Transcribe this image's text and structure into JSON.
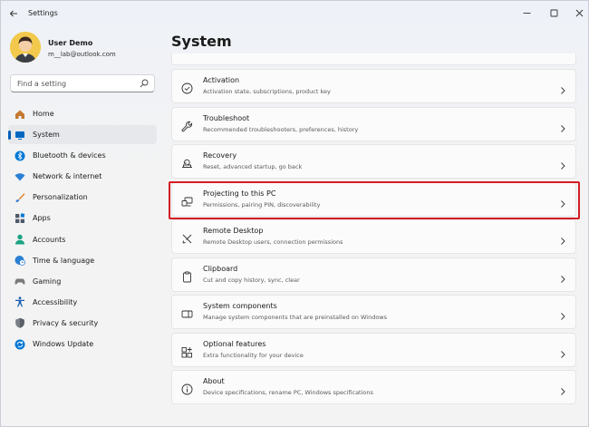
{
  "window": {
    "title": "Settings",
    "back_icon": "arrow-left-icon",
    "controls": [
      "minimize-icon",
      "maximize-icon",
      "close-icon"
    ]
  },
  "profile": {
    "name": "User Demo",
    "email": "m__lab@outlook.com"
  },
  "search": {
    "placeholder": "Find a setting",
    "icon": "search-icon"
  },
  "sidebar": {
    "selected": "System",
    "items": [
      {
        "label": "Home",
        "icon": "home-icon",
        "color": "#c47a30"
      },
      {
        "label": "System",
        "icon": "monitor-icon",
        "color": "#0067c0"
      },
      {
        "label": "Bluetooth & devices",
        "icon": "bluetooth-icon",
        "color": "#0078d4"
      },
      {
        "label": "Network & internet",
        "icon": "wifi-icon",
        "color": "#2a7fd4"
      },
      {
        "label": "Personalization",
        "icon": "brush-icon",
        "color": "#e0802c"
      },
      {
        "label": "Apps",
        "icon": "apps-icon",
        "color": "#505a6a"
      },
      {
        "label": "Accounts",
        "icon": "person-icon",
        "color": "#1aa383"
      },
      {
        "label": "Time & language",
        "icon": "globe-clock-icon",
        "color": "#2a7fd4"
      },
      {
        "label": "Gaming",
        "icon": "gamepad-icon",
        "color": "#7a7a7a"
      },
      {
        "label": "Accessibility",
        "icon": "accessibility-icon",
        "color": "#1a5fb4"
      },
      {
        "label": "Privacy & security",
        "icon": "shield-icon",
        "color": "#7a7f87"
      },
      {
        "label": "Windows Update",
        "icon": "update-icon",
        "color": "#0078d4"
      }
    ]
  },
  "main": {
    "title": "System",
    "highlight_color": "#d41c24",
    "cards": [
      {
        "title": "Activation",
        "desc": "Activation state, subscriptions, product key",
        "icon": "check-circle-icon"
      },
      {
        "title": "Troubleshoot",
        "desc": "Recommended troubleshooters, preferences, history",
        "icon": "wrench-icon"
      },
      {
        "title": "Recovery",
        "desc": "Reset, advanced startup, go back",
        "icon": "recovery-icon"
      },
      {
        "title": "Projecting to this PC",
        "desc": "Permissions, pairing PIN, discoverability",
        "icon": "projecting-icon"
      },
      {
        "title": "Remote Desktop",
        "desc": "Remote Desktop users, connection permissions",
        "icon": "remote-desktop-icon"
      },
      {
        "title": "Clipboard",
        "desc": "Cut and copy history, sync, clear",
        "icon": "clipboard-icon"
      },
      {
        "title": "System components",
        "desc": "Manage system components that are preinstalled on Windows",
        "icon": "components-icon"
      },
      {
        "title": "Optional features",
        "desc": "Extra functionality for your device",
        "icon": "optional-features-icon"
      },
      {
        "title": "About",
        "desc": "Device specifications, rename PC, Windows specifications",
        "icon": "info-icon"
      }
    ]
  }
}
